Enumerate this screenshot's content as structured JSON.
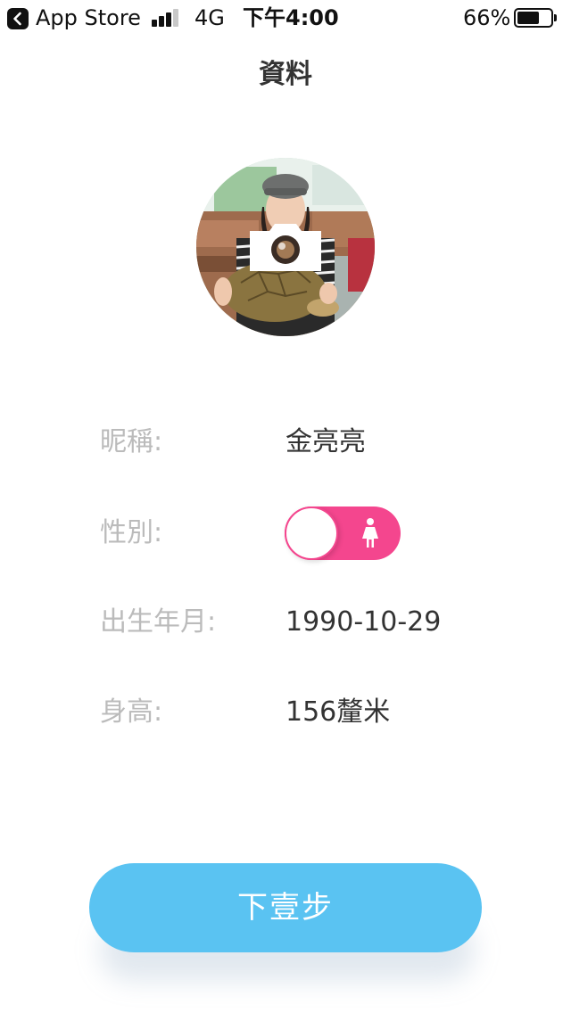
{
  "status_bar": {
    "back_app": "App Store",
    "network": "4G",
    "time": "下午4:00",
    "battery_percent": "66%",
    "battery_level": 0.66,
    "signal_bars": 3,
    "icons": [
      "back-arrow-icon",
      "signal-icon",
      "battery-icon"
    ]
  },
  "header": {
    "title": "資料"
  },
  "avatar": {
    "overlay_icon": "camera-icon"
  },
  "profile": {
    "nickname": {
      "label": "昵稱:",
      "value": "金亮亮"
    },
    "gender": {
      "label": "性別:",
      "value_icon": "female-icon",
      "toggle_color": "#f4468e"
    },
    "birth": {
      "label": "出生年月:",
      "value": "1990-10-29"
    },
    "height": {
      "label": "身高:",
      "value": "156釐米"
    }
  },
  "footer": {
    "next_label": "下壹步",
    "next_color": "#5ac3f2"
  }
}
